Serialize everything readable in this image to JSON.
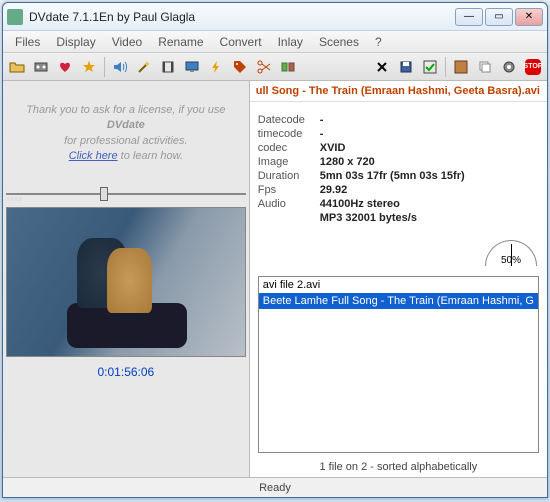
{
  "window": {
    "title": "DVdate 7.1.1En by Paul Glagla"
  },
  "menu": {
    "files": "Files",
    "display": "Display",
    "video": "Video",
    "rename": "Rename",
    "convert": "Convert",
    "inlay": "Inlay",
    "scenes": "Scenes",
    "help": "?"
  },
  "trial": {
    "line1": "Thank you to ask for a license, if you use ",
    "bold": "DVdate",
    "line2": "for professional activities.",
    "link": "Click here",
    "line3": " to learn how."
  },
  "timecode_display": "0:01:56:06",
  "current_file": "ull Song - The Train (Emraan Hashmi, Geeta Basra).avi",
  "info": {
    "datecode_label": "Datecode",
    "datecode": "-",
    "timecode_label": "timecode",
    "timecode": "-",
    "codec_label": "codec",
    "codec": "XVID",
    "image_label": "Image",
    "image": "1280 x 720",
    "duration_label": "Duration",
    "duration": "5mn 03s 17fr (5mn 03s 15fr)",
    "fps_label": "Fps",
    "fps": "29.92",
    "audio_label": "Audio",
    "audio": "44100Hz  stereo",
    "audio2": "MP3 32001 bytes/s"
  },
  "gauge": {
    "value": "50%"
  },
  "files": {
    "item0": "avi file 2.avi",
    "item1": "Beete Lamhe Full Song - The Train (Emraan Hashmi, G"
  },
  "list_status": "1 file on 2 - sorted alphabetically",
  "status": "Ready"
}
